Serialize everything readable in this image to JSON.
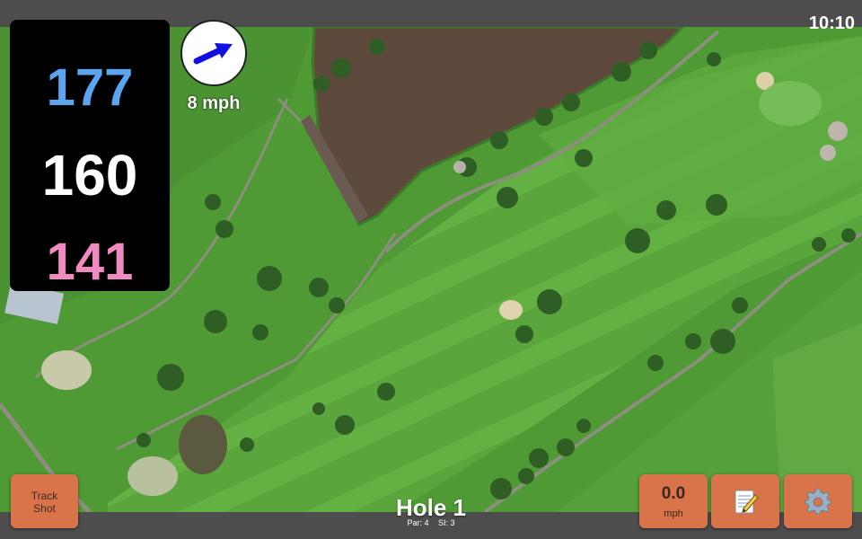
{
  "status_bar": {
    "time": "10:10"
  },
  "yardage": {
    "back": "177",
    "center": "160",
    "front": "141"
  },
  "wind": {
    "speed_label": "8 mph",
    "icon": "wind-arrow-icon",
    "direction": "east-northeast"
  },
  "buttons": {
    "track_shot": {
      "line1": "Track",
      "line2": "Shot"
    },
    "speed": {
      "value": "0.0",
      "unit": "mph"
    },
    "notes": {
      "icon": "notepad-icon"
    },
    "settings": {
      "icon": "gear-icon"
    }
  },
  "hole": {
    "title": "Hole 1",
    "par_label": "Par: 4",
    "si_label": "SI: 3"
  },
  "colors": {
    "button": "#d9744a",
    "back_yardage": "#5aa4f0",
    "front_yardage": "#f08ac0",
    "wind_arrow": "#1010e0"
  }
}
